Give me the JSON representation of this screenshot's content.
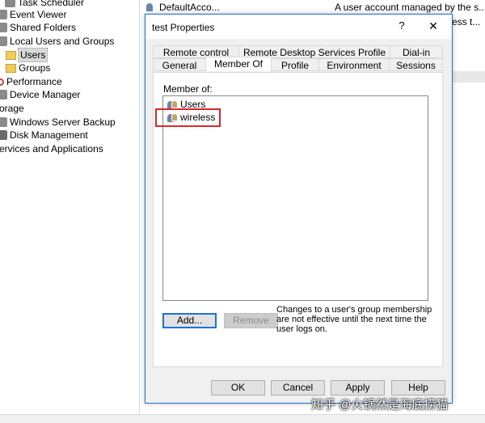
{
  "tree": {
    "items": [
      {
        "label": "Task Scheduler",
        "icon": "clock-icon"
      },
      {
        "label": "Event Viewer",
        "icon": "event-viewer-icon"
      },
      {
        "label": "Shared Folders",
        "icon": "shared-folder-icon"
      },
      {
        "label": "Local Users and Groups",
        "icon": "users-groups-icon"
      },
      {
        "label": "Users",
        "icon": "folder-icon"
      },
      {
        "label": "Groups",
        "icon": "folder-icon"
      },
      {
        "label": "Performance",
        "icon": "performance-icon"
      },
      {
        "label": "Device Manager",
        "icon": "device-manager-icon"
      },
      {
        "label": "orage",
        "icon": ""
      },
      {
        "label": "Windows Server Backup",
        "icon": "backup-icon"
      },
      {
        "label": "Disk Management",
        "icon": "disk-icon"
      },
      {
        "label": "ervices and Applications",
        "icon": ""
      }
    ]
  },
  "list": {
    "row1_name": "DefaultAcco...",
    "row1_desc": "A user account managed by the s...",
    "row2_desc": "ess t..."
  },
  "dialog": {
    "title": "test Properties",
    "help_label": "?",
    "close_label": "✕",
    "tabs_back": [
      "Remote control",
      "Remote Desktop Services Profile",
      "Dial-in"
    ],
    "tabs_front": [
      "General",
      "Member Of",
      "Profile",
      "Environment",
      "Sessions"
    ],
    "active_tab": "Member Of",
    "member_of_label": "Member of:",
    "members": [
      "Users",
      "wireless"
    ],
    "add_label": "Add...",
    "remove_label": "Remove",
    "note": "Changes to a user's group membership are not effective until the next time the user logs on.",
    "ok_label": "OK",
    "cancel_label": "Cancel",
    "apply_label": "Apply",
    "help_button_label": "Help"
  },
  "watermark": "知乎 @火锅然是海底捞猫"
}
